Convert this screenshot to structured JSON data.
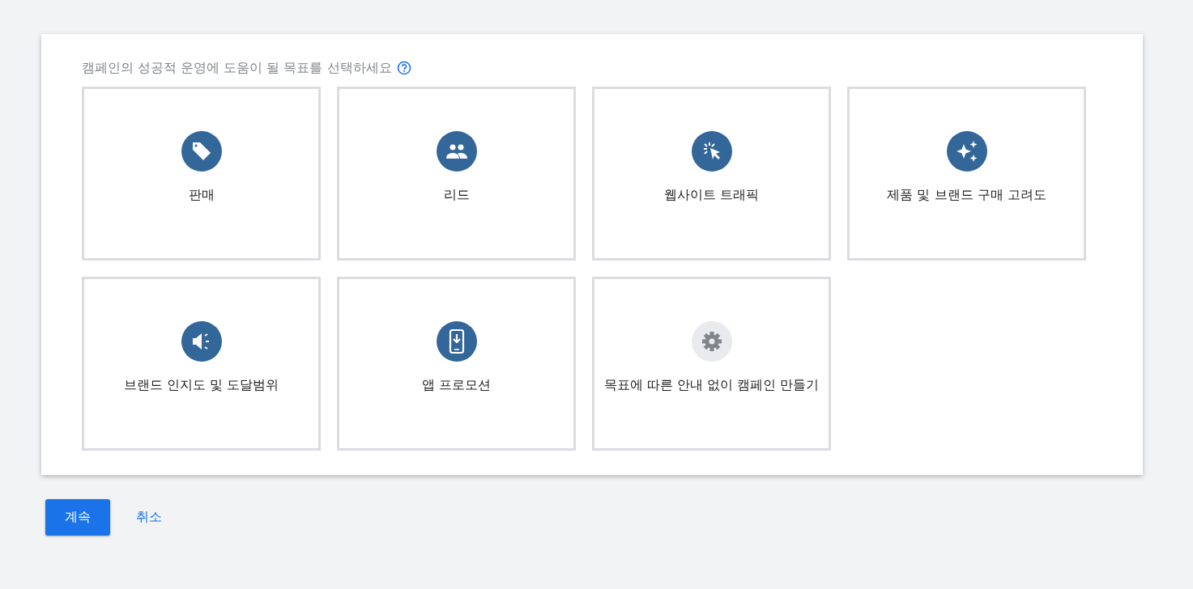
{
  "prompt": "캠페인의 성공적 운영에 도움이 될 목표를 선택하세요",
  "goals": [
    {
      "kind": "sales",
      "label": "판매"
    },
    {
      "kind": "leads",
      "label": "리드"
    },
    {
      "kind": "traffic",
      "label": "웹사이트 트래픽"
    },
    {
      "kind": "consideration",
      "label": "제품 및 브랜드 구매 고려도"
    },
    {
      "kind": "awareness",
      "label": "브랜드 인지도 및 도달범위"
    },
    {
      "kind": "app",
      "label": "앱 프로모션"
    },
    {
      "kind": "none",
      "label": "목표에 따른 안내 없이 캠페인 만들기"
    }
  ],
  "buttons": {
    "primary": "계속",
    "secondary": "취소"
  }
}
